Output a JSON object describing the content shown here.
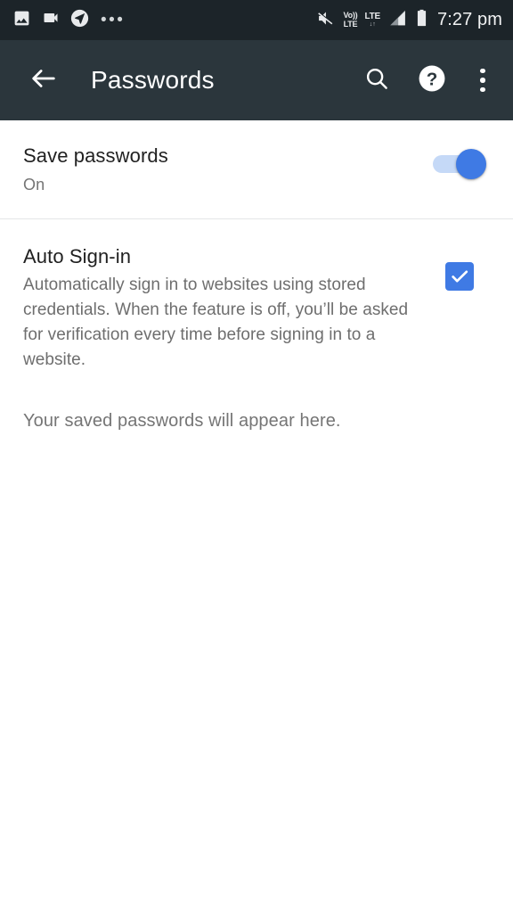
{
  "status_bar": {
    "time": "7:27 pm",
    "left_icons": [
      "image-icon",
      "video-camera-icon",
      "location-icon",
      "more-notifications-ellipsis"
    ],
    "ellipsis": "•••",
    "right_icons": [
      "volume-mute-icon",
      "volte-icon",
      "lte-data-icon",
      "signal-bars-icon",
      "battery-icon"
    ],
    "volte_top": "Vo))",
    "volte_bottom": "LTE",
    "lte_label": "LTE",
    "lte_arrows": "↓↑"
  },
  "app_bar": {
    "back_icon": "arrow-back-icon",
    "title": "Passwords",
    "search_icon": "search-icon",
    "help_icon": "help-circle-icon",
    "overflow_icon": "more-vert-icon"
  },
  "preferences": [
    {
      "title": "Save passwords",
      "summary": "On",
      "widget": "switch",
      "checked": true
    },
    {
      "title": "Auto Sign-in",
      "description": "Automatically sign in to websites using stored credentials. When the feature is off, you’ll be asked for verification every time before signing in to a website.",
      "widget": "checkbox",
      "checked": true
    }
  ],
  "empty_state": {
    "message": "Your saved passwords will appear here."
  },
  "colors": {
    "status_bar_bg": "#1c2429",
    "app_bar_bg": "#2b363c",
    "accent": "#3f7ae4",
    "switch_track": "#c5d9f7",
    "title_text": "#212121",
    "secondary_text": "#757575",
    "divider": "#e4e6e7",
    "page_bg": "#ffffff"
  }
}
